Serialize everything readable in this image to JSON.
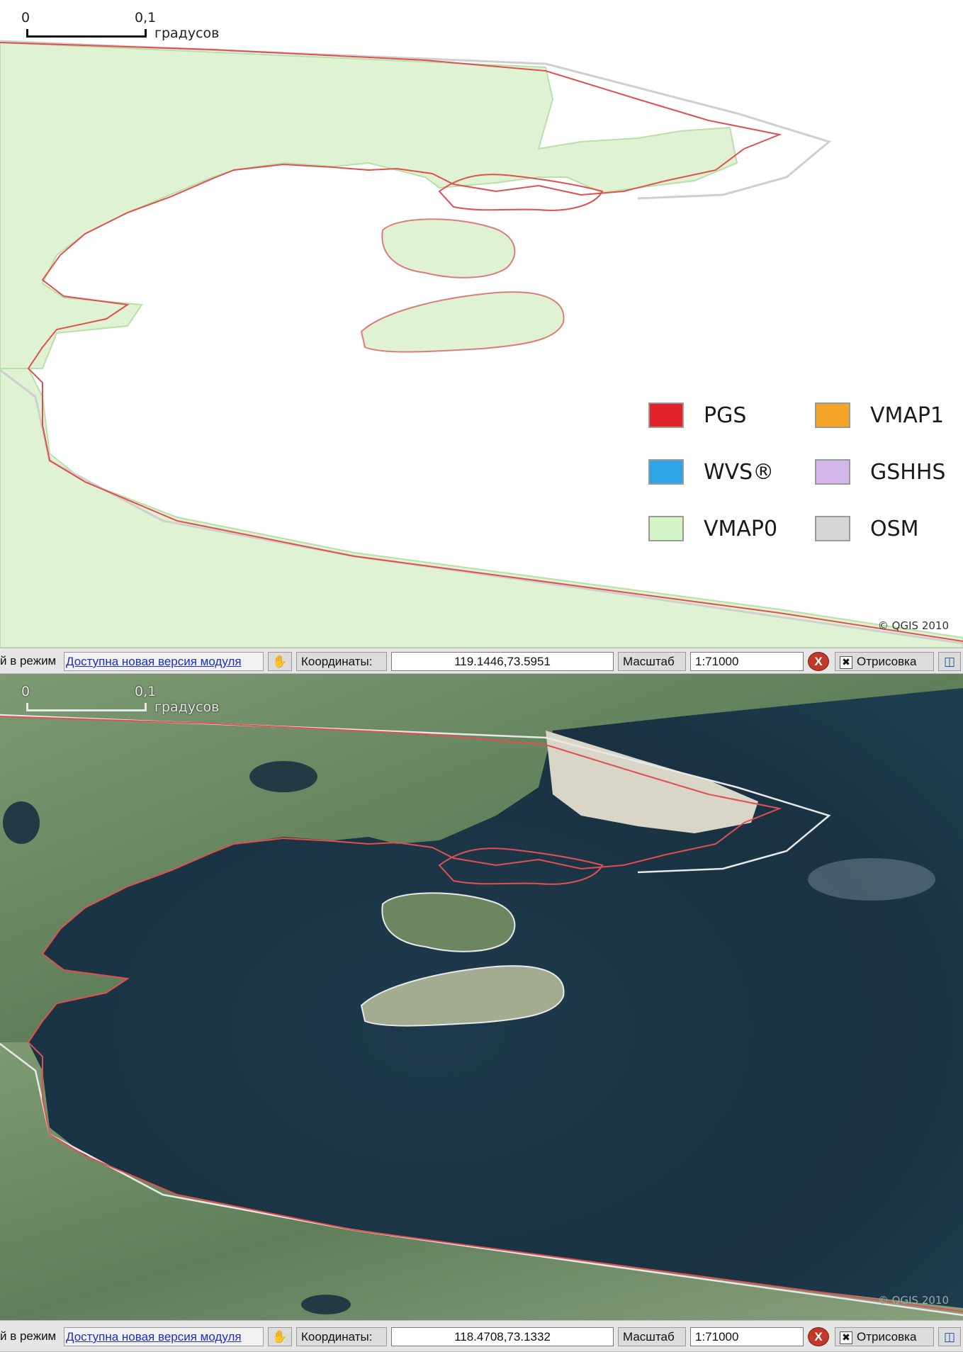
{
  "top_map": {
    "scale_bar": {
      "start": "0",
      "end": "0,1",
      "unit": "градусов"
    },
    "legend": [
      {
        "label": "PGS",
        "color": "#e0242a"
      },
      {
        "label": "VMAP1",
        "color": "#f4a426"
      },
      {
        "label": "WVS®",
        "color": "#2ea3e6"
      },
      {
        "label": "GSHHS",
        "color": "#d3b7ea"
      },
      {
        "label": "VMAP0",
        "color": "#d3f5c8"
      },
      {
        "label": "OSM",
        "color": "#d6d6d6"
      }
    ],
    "copyright": "© QGIS 2010"
  },
  "status_top": {
    "mode_text": "й в режим",
    "plugin_link": "Доступна новая версия модуля",
    "coords_label": "Координаты:",
    "coords_value": "119.1446,73.5951",
    "scale_label": "Масштаб",
    "scale_value": "1:71000",
    "render_label": "Отрисовка"
  },
  "bottom_map": {
    "scale_bar": {
      "start": "0",
      "end": "0,1",
      "unit": "градусов"
    },
    "copyright": "© QGIS 2010"
  },
  "status_bottom": {
    "mode_text": "й в режим",
    "plugin_link": "Доступна новая версия модуля",
    "coords_label": "Координаты:",
    "coords_value": "118.4708,73.1332",
    "scale_label": "Масштаб",
    "scale_value": "1:71000",
    "render_label": "Отрисовка"
  },
  "icons": {
    "map_tool": "hand-pan-icon",
    "stop": "stop-render-icon",
    "render_checkbox": "checkbox-icon",
    "projection": "projection-icon"
  }
}
